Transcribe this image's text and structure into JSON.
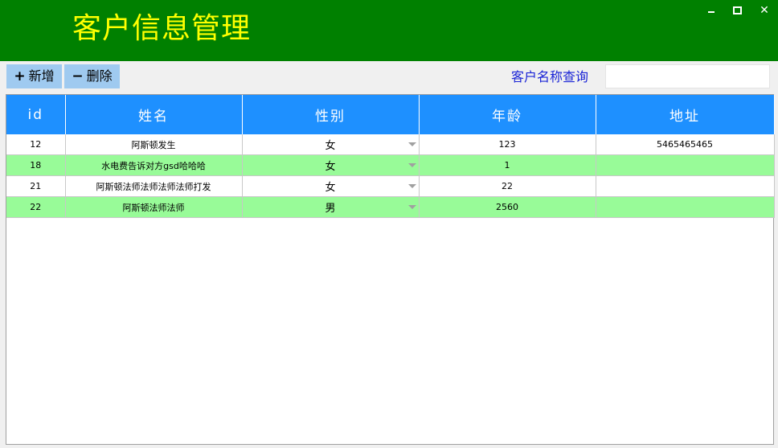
{
  "window": {
    "title": "客户信息管理",
    "controls": [
      "minimize",
      "maximize",
      "close"
    ]
  },
  "toolbar": {
    "add_icon": "+",
    "add_label": "新增",
    "delete_icon": "−",
    "delete_label": "删除",
    "search_label": "客户名称查询",
    "search_value": "",
    "search_placeholder": ""
  },
  "table": {
    "columns": [
      "id",
      "姓名",
      "性别",
      "年龄",
      "地址"
    ],
    "rows": [
      {
        "id": "12",
        "name": "阿斯顿发生",
        "gender": "女",
        "age": "123",
        "address": "5465465465"
      },
      {
        "id": "18",
        "name": "水电费告诉对方gsd哈哈哈",
        "gender": "女",
        "age": "1",
        "address": ""
      },
      {
        "id": "21",
        "name": "阿斯顿法师法师法师法师打发",
        "gender": "女",
        "age": "22",
        "address": ""
      },
      {
        "id": "22",
        "name": "阿斯顿法师法师",
        "gender": "男",
        "age": "2560",
        "address": ""
      }
    ]
  },
  "colors": {
    "title_bar": "#008000",
    "title_text": "#ffff00",
    "header_bg": "#1e90ff",
    "alt_row": "#98fb98",
    "button_bg": "#9fcaf0",
    "search_label": "#1a24d6"
  },
  "icons": {
    "add": "plus-icon",
    "delete": "minus-icon",
    "dropdown": "chevron-down-icon"
  }
}
